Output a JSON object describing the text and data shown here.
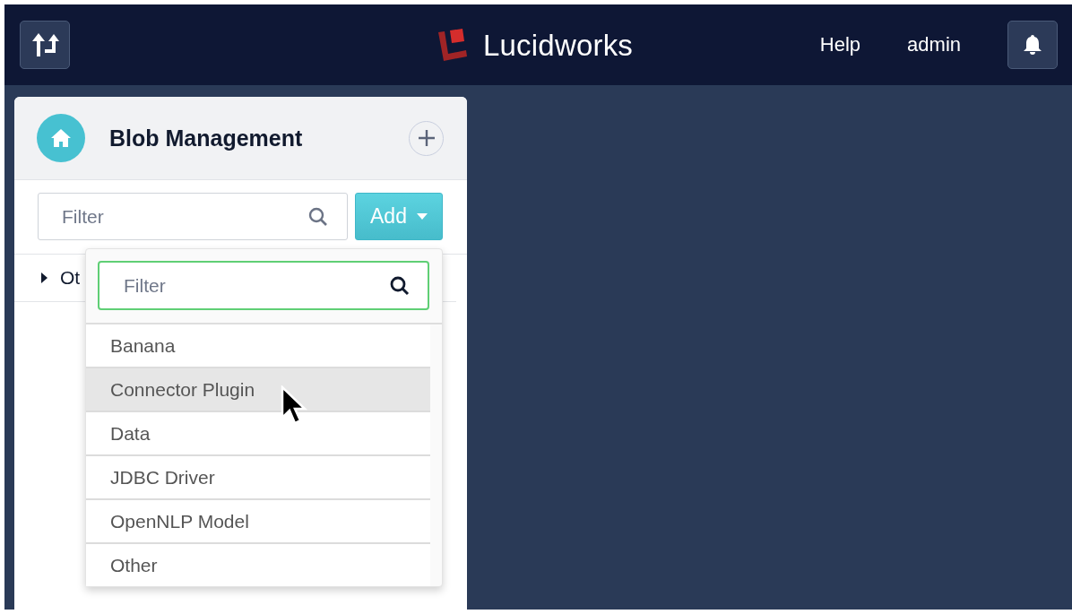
{
  "header": {
    "brand": "Lucidworks",
    "links": [
      "Help",
      "admin"
    ]
  },
  "panel": {
    "title": "Blob Management",
    "filter": {
      "placeholder": "Filter"
    },
    "add_button": "Add",
    "tree": [
      {
        "label": "Ot",
        "expanded": false
      }
    ]
  },
  "dropdown": {
    "filter": {
      "placeholder": "Filter"
    },
    "items": [
      {
        "label": "Banana",
        "highlighted": false
      },
      {
        "label": "Connector Plugin",
        "highlighted": true
      },
      {
        "label": "Data",
        "highlighted": false
      },
      {
        "label": "JDBC Driver",
        "highlighted": false
      },
      {
        "label": "OpenNLP Model",
        "highlighted": false
      },
      {
        "label": "Other",
        "highlighted": false
      }
    ]
  }
}
